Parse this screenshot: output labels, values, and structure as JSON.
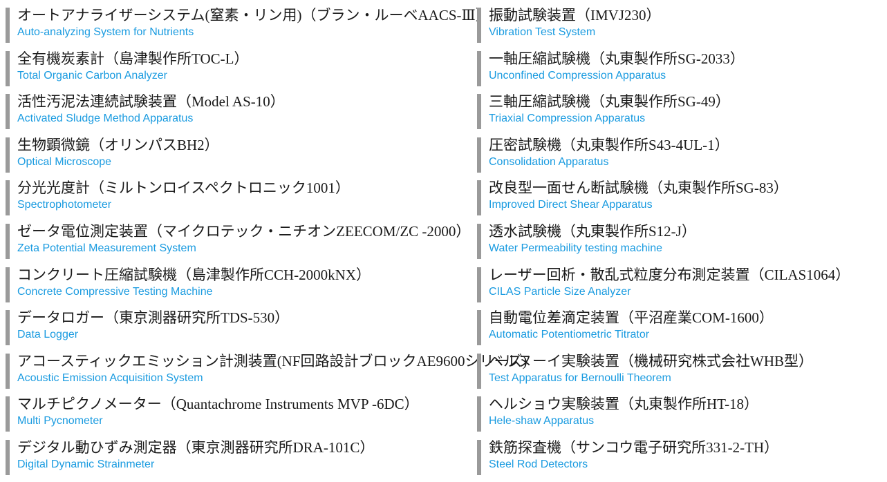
{
  "accent_color": "#1a9be0",
  "left_items": [
    {
      "ja": "オートアナライザーシステム(窒素・リン用)（ブラン・ルーベAACS-Ⅲ）",
      "en": "Auto-analyzing System for Nutrients"
    },
    {
      "ja": "全有機炭素計（島津製作所TOC-L）",
      "en": "Total Organic Carbon Analyzer"
    },
    {
      "ja": "活性汚泥法連続試験装置（Model AS-10）",
      "en": "Activated Sludge Method Apparatus"
    },
    {
      "ja": "生物顕微鏡（オリンパスBH2）",
      "en": "Optical Microscope"
    },
    {
      "ja": "分光光度計（ミルトンロイスペクトロニック1001）",
      "en": "Spectrophotometer"
    },
    {
      "ja": "ゼータ電位測定装置（マイクロテック・ニチオンZEECOM/ZC -2000）",
      "en": "Zeta Potential Measurement System"
    },
    {
      "ja": "コンクリート圧縮試験機（島津製作所CCH-2000kNX）",
      "en": "Concrete Compressive Testing Machine"
    },
    {
      "ja": "データロガー（東京測器研究所TDS-530）",
      "en": "Data Logger"
    },
    {
      "ja": "アコースティックエミッション計測装置(NF回路設計ブロックAE9600シリーズ)",
      "en": "Acoustic Emission Acquisition System"
    },
    {
      "ja": "マルチピクノメーター（Quantachrome Instruments MVP -6DC）",
      "en": "Multi Pycnometer"
    },
    {
      "ja": "デジタル動ひずみ測定器（東京測器研究所DRA-101C）",
      "en": "Digital Dynamic Strainmeter"
    }
  ],
  "right_items": [
    {
      "ja": "振動試験装置（IMVJ230）",
      "en": "Vibration Test System"
    },
    {
      "ja": "一軸圧縮試験機（丸東製作所SG-2033）",
      "en": "Unconfined Compression Apparatus"
    },
    {
      "ja": "三軸圧縮試験機（丸東製作所SG-49）",
      "en": "Triaxial Compression Apparatus"
    },
    {
      "ja": "圧密試験機（丸東製作所S43-4UL-1）",
      "en": "Consolidation Apparatus"
    },
    {
      "ja": "改良型一面せん断試験機（丸東製作所SG-83）",
      "en": "Improved Direct Shear Apparatus"
    },
    {
      "ja": "透水試験機（丸東製作所S12-J）",
      "en": "Water Permeability testing machine"
    },
    {
      "ja": "レーザー回析・散乱式粒度分布測定装置（CILAS1064）",
      "en": "CILAS Particle Size Analyzer"
    },
    {
      "ja": "自動電位差滴定装置（平沼産業COM-1600）",
      "en": "Automatic Potentiometric Titrator"
    },
    {
      "ja": "ベルヌーイ実験装置（機械研究株式会社WHB型）",
      "en": "Test Apparatus for Bernoulli Theorem"
    },
    {
      "ja": "ヘルショウ実験装置（丸東製作所HT-18）",
      "en": "Hele-shaw Apparatus"
    },
    {
      "ja": "鉄筋探査機（サンコウ電子研究所331-2-TH）",
      "en": "Steel Rod Detectors"
    }
  ]
}
